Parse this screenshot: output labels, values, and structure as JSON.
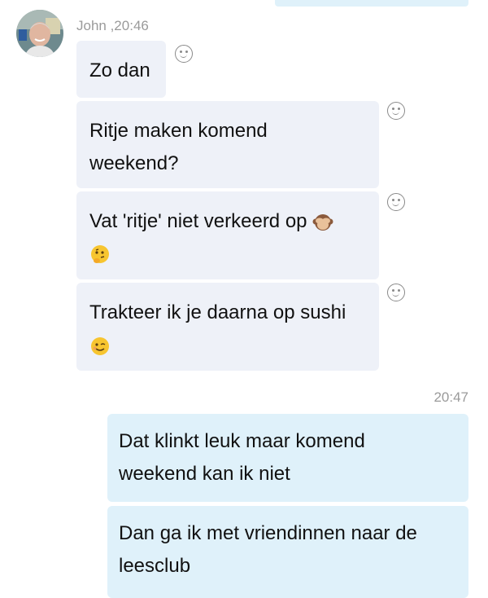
{
  "incoming": {
    "sender_meta": "John ,20:46",
    "messages": [
      {
        "text": "Zo dan"
      },
      {
        "text": "Ritje maken komend\nweekend?"
      },
      {
        "text": "Vat 'ritje' niet verkeerd op",
        "emojis": [
          "see-no-evil-monkey",
          "thinking-face"
        ]
      },
      {
        "text": "Trakteer ik je daarna op sushi",
        "emojis": [
          "winking-face"
        ]
      }
    ]
  },
  "outgoing": {
    "time": "20:47",
    "messages": [
      {
        "text": "Dat klinkt leuk maar komend\nweekend kan ik niet"
      },
      {
        "text": "Dan ga ik met vriendinnen naar de\nleesclub"
      }
    ]
  },
  "colors": {
    "incoming_bubble": "#eef1f8",
    "outgoing_bubble": "#dff1fa",
    "meta_text": "#9a9a9a"
  }
}
